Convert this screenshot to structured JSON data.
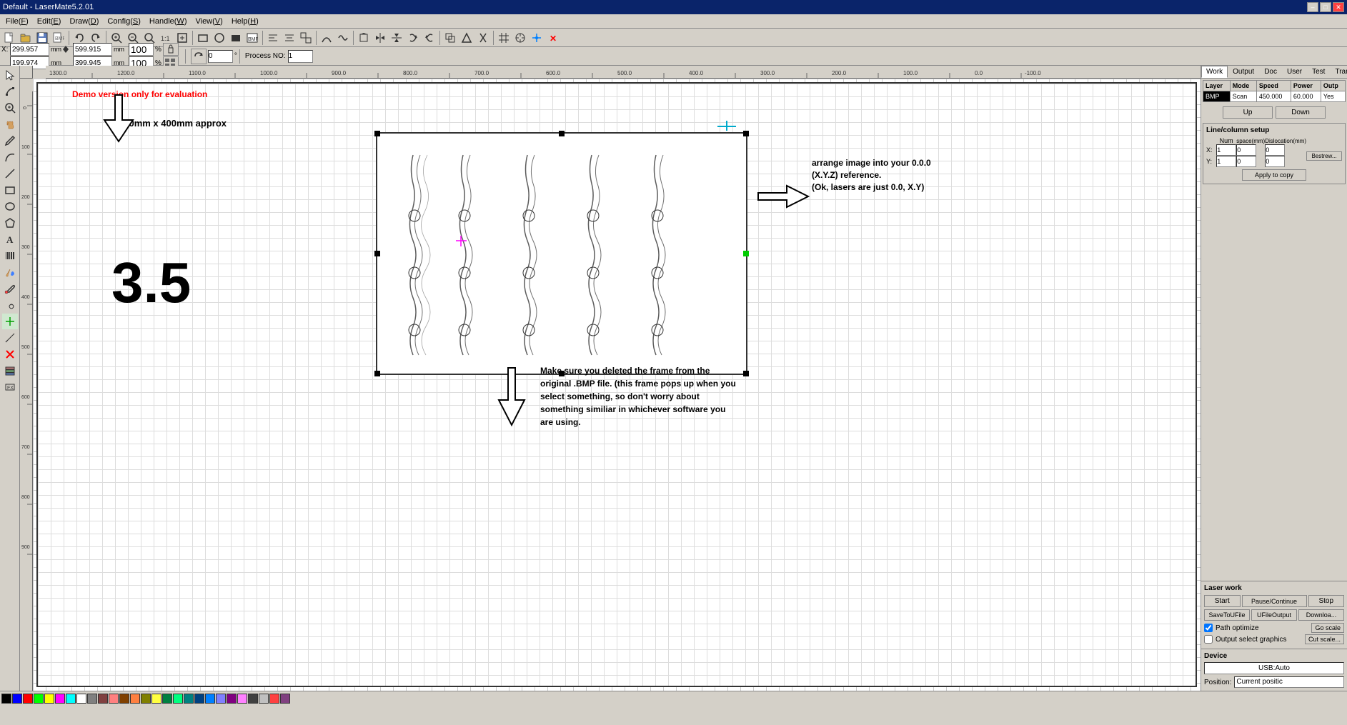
{
  "titleBar": {
    "title": "Default - LaserMate5.2.01",
    "minBtn": "–",
    "maxBtn": "□",
    "closeBtn": "✕"
  },
  "menuBar": {
    "items": [
      {
        "label": "File(F)",
        "key": "F"
      },
      {
        "label": "Edit(E)",
        "key": "E"
      },
      {
        "label": "Draw(D)",
        "key": "D"
      },
      {
        "label": "Config(S)",
        "key": "S"
      },
      {
        "label": "Handle(W)",
        "key": "W"
      },
      {
        "label": "View(V)",
        "key": "V"
      },
      {
        "label": "Help(H)",
        "key": "H"
      }
    ]
  },
  "coordsBar": {
    "xLabel": "X:",
    "xValue": "299.957",
    "yLabel": "",
    "yValue": "199.974",
    "xSize": "599.915",
    "ySize": "399.945",
    "pct1": "100",
    "pct2": "100",
    "pctSymbol": "%",
    "rotValue": "0",
    "rotSymbol": "°",
    "processLabel": "Process NO:",
    "processValue": "1"
  },
  "canvas": {
    "demoText": "Demo version only for evaluation",
    "sizeText": "600mm x 400mm approx",
    "bigNumber": "3.5",
    "bmpArrowText": "arrange image into your 0.0.0 (X.Y.Z) reference.\n(Ok, lasers are just 0.0, X.Y)",
    "bottomArrowText": "Make sure you deleted the frame from the original .BMP file. (this frame pops up when you select something, so don't worry about something similiar in whichever software you are using."
  },
  "rightPanel": {
    "tabs": [
      "Work",
      "Output",
      "Doc",
      "User",
      "Test",
      "Transfo"
    ],
    "activeTab": "Work",
    "layerTable": {
      "headers": [
        "Layer",
        "Mode",
        "Speed",
        "Power",
        "Outp"
      ],
      "rows": [
        {
          "layer": "BMP",
          "mode": "Scan",
          "speed": "450.000",
          "power": "60.000",
          "output": "Yes"
        }
      ]
    },
    "upBtn": "Up",
    "downBtn": "Down",
    "lineColumnSetup": {
      "title": "Line/column setup",
      "numLabel": "Num",
      "spaceLabel": "space(mm)",
      "dislocationLabel": "Dislocation(mm)",
      "xLabel": "X:",
      "xNum": "1",
      "xSpace": "0",
      "xDisloc": "0",
      "yLabel": "Y:",
      "yNum": "1",
      "ySpace": "0",
      "yDisloc": "0",
      "bestrew": "Bestrew...",
      "applyToCopy": "Apply to copy"
    },
    "laserWork": {
      "title": "Laser work",
      "startBtn": "Start",
      "pauseBtn": "Pause/Continue",
      "stopBtn": "Stop",
      "saveToFileBtn": "SaveToUFile",
      "uFileOutputBtn": "UFileOutput",
      "downloadBtn": "Downloa...",
      "pathOptimize": "Path optimize",
      "outputSelectGraphics": "Output select graphics",
      "goScaleBtn": "Go scale",
      "cutScaleBtn": "Cut scale..."
    },
    "device": {
      "title": "Device",
      "usbValue": "USB:Auto",
      "positionLabel": "Position:",
      "currentPosition": "Current positic"
    }
  },
  "statusBar": {
    "colors": [
      "#000000",
      "#0000ff",
      "#ff0000",
      "#00ff00",
      "#ffff00",
      "#ff00ff",
      "#00ffff",
      "#ffffff",
      "#808080",
      "#804040",
      "#ff8080",
      "#804000",
      "#ff8040",
      "#808000",
      "#ffff40",
      "#008040",
      "#00ff80",
      "#008080",
      "#004080",
      "#0080ff",
      "#8080ff",
      "#800080",
      "#ff80ff",
      "#404040",
      "#c0c0c0",
      "#ff4040",
      "#804080"
    ]
  }
}
